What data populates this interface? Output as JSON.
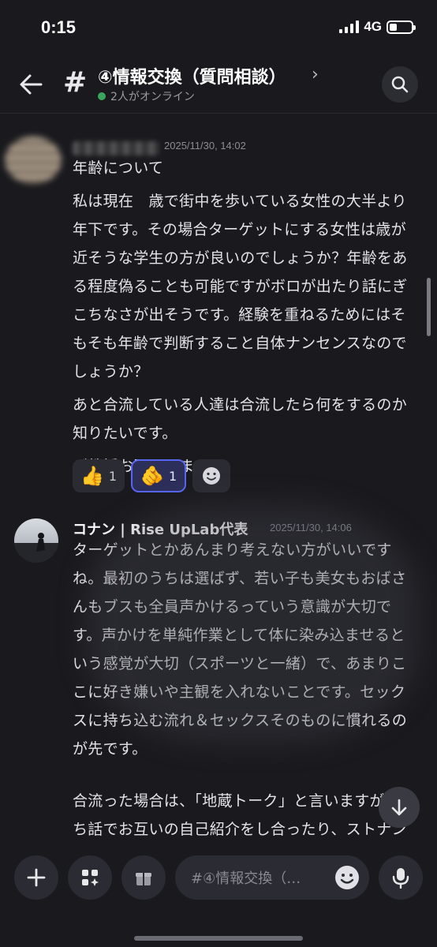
{
  "status": {
    "time": "0:15",
    "network": "4G"
  },
  "header": {
    "channel_name": "④情報交換（質問相談）",
    "online_text": "2人がオンライン"
  },
  "messages": [
    {
      "timestamp": "2025/11/30, 14:02",
      "paragraphs": [
        "年齢について",
        "私は現在　歳で街中を歩いている女性の大半より年下です。その場合ターゲットにする女性は歳が近そうな学生の方が良いのでしょうか？年齢をある程度偽ることも可能ですがボロが出たり話にぎこちなさが出そうです。経験を重ねるためにはそもそも年齢で判断すること自体ナンセンスなのでしょうか？",
        "あと合流している人達は合流したら何をするのか知りたいです。",
        "ご教授お願いします！"
      ],
      "reactions": [
        {
          "emoji": "👍",
          "count": "1",
          "active": false
        },
        {
          "emoji": "🫵",
          "count": "1",
          "active": true
        }
      ]
    },
    {
      "author": "コナン | Rise UpLab代表",
      "timestamp": "2025/11/30, 14:06",
      "paragraphs": [
        "ターゲットとかあんまり考えない方がいいですね。最初のうちは選ばず、若い子も美女もおばさんもブスも全員声かけるっていう意識が大切です。声かけを単純作業として体に染み込ませるという感覚が大切（スポーツと一緒）で、あまりここに好き嫌いや主観を入れないことです。セックスに持ち込む流れ＆セックスそのものに慣れるのが先です。",
        "合流った場合は、「地蔵トーク」と言いますが、立ち話でお互いの自己紹介をし合ったり、ストナンに関する悩みを共有し合って教"
      ]
    }
  ],
  "composer": {
    "placeholder": "#④情報交換（…"
  }
}
